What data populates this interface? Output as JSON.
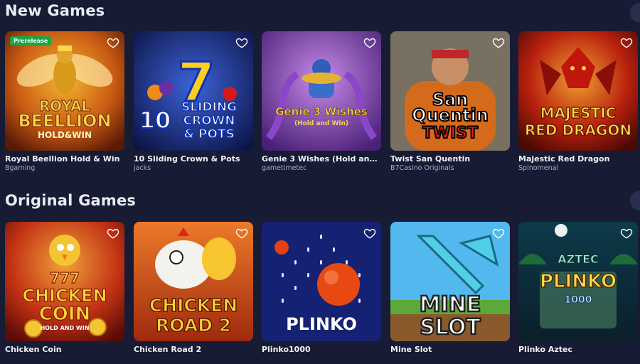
{
  "sections": [
    {
      "title": "New Games",
      "games": [
        {
          "name": "Royal Beellion Hold & Win",
          "provider": "Bgaming",
          "badge": "Prerelease",
          "art_lines": [
            "ROYAL",
            "BEELLION",
            "HOLD&WIN"
          ]
        },
        {
          "name": "10 Sliding Crown & Pots",
          "provider": "jacks",
          "art_lines": [
            "7",
            "10",
            "SLIDING",
            "CROWN",
            "& POTS"
          ]
        },
        {
          "name": "Genie 3 Wishes (Hold and ...",
          "provider": "gametimetec",
          "art_lines": [
            "Genie 3 Wishes",
            "(Hold and Win)"
          ]
        },
        {
          "name": "Twist San Quentin",
          "provider": "B7Casino Originals",
          "art_lines": [
            "San",
            "Quentin",
            "TWIST"
          ]
        },
        {
          "name": "Majestic Red Dragon",
          "provider": "Spinomenal",
          "art_lines": [
            "MAJESTIC",
            "RED DRAGON"
          ]
        }
      ]
    },
    {
      "title": "Original Games",
      "games": [
        {
          "name": "Chicken Coin",
          "provider": "",
          "art_lines": [
            "777",
            "CHICKEN",
            "COIN",
            "HOLD AND WIN"
          ]
        },
        {
          "name": "Chicken Road 2",
          "provider": "",
          "art_lines": [
            "CHICKEN",
            "ROAD 2"
          ]
        },
        {
          "name": "Plinko1000",
          "provider": "",
          "art_lines": [
            "PLINKO"
          ]
        },
        {
          "name": "Mine Slot",
          "provider": "",
          "art_lines": [
            "MINE",
            "SLOT"
          ]
        },
        {
          "name": "Plinko Aztec",
          "provider": "",
          "art_lines": [
            "AZTEC",
            "PLINKO",
            "1000"
          ]
        }
      ]
    }
  ],
  "colors": {
    "background": "#171b33",
    "badge": "#17a744",
    "provider_text": "#a9adc4"
  },
  "icons": {
    "favorite": "heart-outline-icon",
    "scroll": "chevron-right-icon"
  }
}
